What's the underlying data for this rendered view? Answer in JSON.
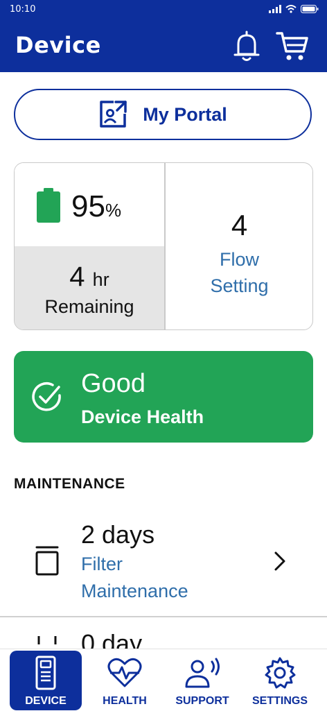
{
  "status_bar": {
    "time": "10:10"
  },
  "header": {
    "title": "Device"
  },
  "portal": {
    "label": "My Portal"
  },
  "stats": {
    "battery_value": "95",
    "battery_unit": "%",
    "battery_level": 0.95,
    "remaining_value": "4",
    "remaining_unit": "hr",
    "remaining_label": "Remaining",
    "flow_value": "4",
    "flow_label_line1": "Flow",
    "flow_label_line2": "Setting"
  },
  "health": {
    "status": "Good",
    "label": "Device Health"
  },
  "maintenance": {
    "title": "MAINTENANCE",
    "items": [
      {
        "value": "2 days",
        "label_line1": "Filter",
        "label_line2": "Maintenance",
        "icon": "filter-icon"
      },
      {
        "value": "0 day",
        "icon": "item-icon"
      }
    ]
  },
  "tabs": [
    {
      "label": "DEVICE",
      "icon": "device-icon",
      "active": true
    },
    {
      "label": "HEALTH",
      "icon": "heart-rate-icon",
      "active": false
    },
    {
      "label": "SUPPORT",
      "icon": "support-person-icon",
      "active": false
    },
    {
      "label": "SETTINGS",
      "icon": "gear-icon",
      "active": false
    }
  ],
  "colors": {
    "brand": "#0d2f9c",
    "link": "#2f6eaa",
    "good": "#22a456",
    "battery": "#22a456"
  }
}
